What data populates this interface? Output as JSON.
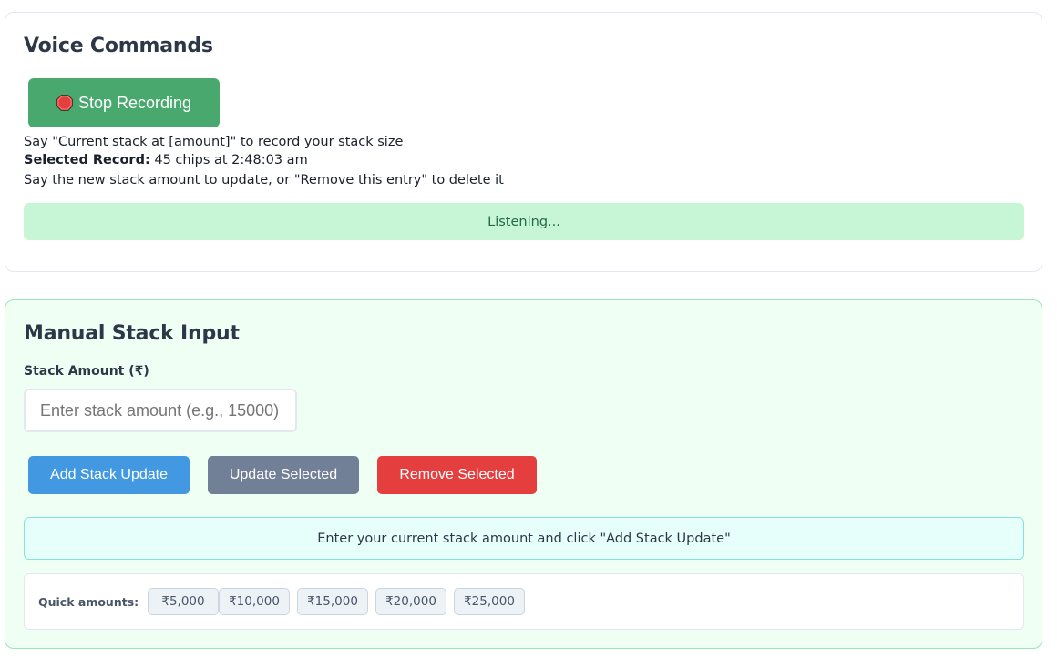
{
  "voice": {
    "title": "Voice Commands",
    "record_button_label": "Stop Recording",
    "instruction": "Say \"Current stack at [amount]\" to record your stack size",
    "selected_label": "Selected Record:",
    "selected_value": " 45 chips at 2:48:03 am",
    "update_hint": "Say the new stack amount to update, or \"Remove this entry\" to delete it",
    "status": "Listening..."
  },
  "manual": {
    "title": "Manual Stack Input",
    "field_label": "Stack Amount (₹)",
    "input_value": "",
    "input_placeholder": "Enter stack amount (e.g., 15000)",
    "buttons": {
      "add": "Add Stack Update",
      "update": "Update Selected",
      "remove": "Remove Selected"
    },
    "info": "Enter your current stack amount and click \"Add Stack Update\"",
    "quick_label": "Quick amounts:",
    "quick_amounts": [
      "₹5,000",
      "₹10,000",
      "₹15,000",
      "₹20,000",
      "₹25,000"
    ]
  },
  "colors": {
    "record_button": "#48a86e",
    "status_bg": "#c6f6d5",
    "add_button": "#4299e1",
    "update_button": "#718096",
    "remove_button": "#e53e3e",
    "info_bg": "#e6fffa"
  },
  "icons": {
    "record_button_icon": "stop-sign-icon"
  }
}
